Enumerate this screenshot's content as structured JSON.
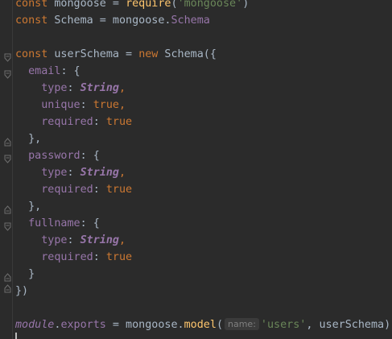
{
  "code": {
    "l1": {
      "t1": "const",
      "t2": " mongoose = ",
      "t3": "require",
      "t4": "(",
      "t5": "'mongoose'",
      "t6": ")"
    },
    "l2": {
      "t1": "const",
      "t2": " Schema = mongoose.",
      "t3": "Schema"
    },
    "l4": {
      "t1": "const",
      "t2": " userSchema = ",
      "t3": "new",
      "t4": " Schema({"
    },
    "l5": {
      "t1": "  ",
      "t2": "email",
      "t3": ": {"
    },
    "l6": {
      "t1": "    ",
      "t2": "type",
      "t3": ": ",
      "t4": "String",
      "t5": ","
    },
    "l7": {
      "t1": "    ",
      "t2": "unique",
      "t3": ": ",
      "t4": "true",
      "t5": ","
    },
    "l8": {
      "t1": "    ",
      "t2": "required",
      "t3": ": ",
      "t4": "true"
    },
    "l9": {
      "t1": "  },",
      "t2": ""
    },
    "l10": {
      "t1": "  ",
      "t2": "password",
      "t3": ": {"
    },
    "l11": {
      "t1": "    ",
      "t2": "type",
      "t3": ": ",
      "t4": "String",
      "t5": ","
    },
    "l12": {
      "t1": "    ",
      "t2": "required",
      "t3": ": ",
      "t4": "true"
    },
    "l13": {
      "t1": "  },",
      "t2": ""
    },
    "l14": {
      "t1": "  ",
      "t2": "fullname",
      "t3": ": {"
    },
    "l15": {
      "t1": "    ",
      "t2": "type",
      "t3": ": ",
      "t4": "String",
      "t5": ","
    },
    "l16": {
      "t1": "    ",
      "t2": "required",
      "t3": ": ",
      "t4": "true"
    },
    "l17": {
      "t1": "  }"
    },
    "l18": {
      "t1": "})"
    },
    "l20": {
      "t1": "module",
      "t2": ".",
      "t3": "exports",
      "t4": " = mongoose.",
      "t5": "model",
      "t6": "(",
      "hint": "name:",
      "t7": "'users'",
      "t8": ", userSchema)"
    }
  },
  "colors": {
    "background": "#2b2b2b",
    "keyword": "#cc7832",
    "string": "#6a8759",
    "property": "#9876aa",
    "function": "#ffc66d",
    "plain": "#a9b7c6"
  },
  "icons": {
    "fold_open": "fold-open-icon",
    "fold_close": "fold-close-icon"
  }
}
